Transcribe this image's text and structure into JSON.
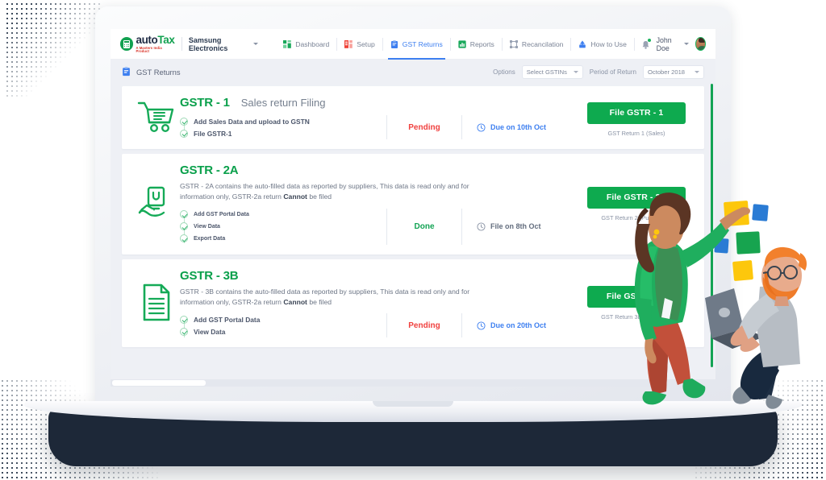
{
  "brand": {
    "logo_word_1": "auto",
    "logo_word_2": "Tax",
    "logo_tagline": "A Masters India Product",
    "company": "Samsung Electronics"
  },
  "nav": {
    "items": [
      {
        "label": "Dashboard",
        "icon": "grid-icon",
        "active": false
      },
      {
        "label": "Setup",
        "icon": "setup-icon",
        "active": false
      },
      {
        "label": "GST Returns",
        "icon": "clipboard-icon",
        "active": true
      },
      {
        "label": "Reports",
        "icon": "reports-icon",
        "active": false
      },
      {
        "label": "Recancilation",
        "icon": "reconciliation-icon",
        "active": false
      },
      {
        "label": "How to Use",
        "icon": "help-icon",
        "active": false
      }
    ],
    "user_name": "John Doe"
  },
  "subheader": {
    "title": "GST Returns",
    "options_label": "Options",
    "gstin_select": "Select GSTINs",
    "period_label": "Period of Return",
    "period_select": "October 2018"
  },
  "colors": {
    "brand_green": "#0eaa4f",
    "accent_blue": "#3d7ff0",
    "status_pending": "#f0413f",
    "status_done": "#13a354",
    "navy": "#1f2b44"
  },
  "cards": [
    {
      "id": "gstr-1",
      "icon": "shopping-cart-icon",
      "title": "GSTR - 1",
      "subtitle": "Sales return Filing",
      "description": "",
      "checklist": [
        "Add Sales Data and upload to GSTN",
        "File GSTR-1"
      ],
      "status": "Pending",
      "status_type": "pending",
      "due": "Due on 10th Oct",
      "due_type": "blue",
      "button": "File GSTR - 1",
      "caption": "GST Return 1 (Sales)"
    },
    {
      "id": "gstr-2a",
      "icon": "hand-holding-document-icon",
      "title": "GSTR - 2A",
      "subtitle": "",
      "description_pre": "GSTR - 2A contains the auto-filled data as reported by suppliers, This data is read only and for information only, GSTR-2a return ",
      "description_bold": "Cannot",
      "description_post": " be filed",
      "checklist": [
        "Add GST Portal Data",
        "View Data",
        "Export Data"
      ],
      "status": "Done",
      "status_type": "done",
      "due": "File on 8th Oct",
      "due_type": "grey",
      "button": "File GSTR - 2A",
      "caption": "GST Return 2 (Purchases)"
    },
    {
      "id": "gstr-3b",
      "icon": "document-lines-icon",
      "title": "GSTR - 3B",
      "subtitle": "",
      "description_pre": "GSTR - 3B contains the auto-filled data as reported by suppliers, This data is read only and for information only, GSTR-2a return ",
      "description_bold": "Cannot",
      "description_post": " be filed",
      "checklist": [
        "Add GST Portal Data",
        "View Data"
      ],
      "status": "Pending",
      "status_type": "pending",
      "due": "Due on 20th Oct",
      "due_type": "blue",
      "button": "File GSTR - 3B",
      "caption": "GST Return 3B (summary)"
    }
  ]
}
